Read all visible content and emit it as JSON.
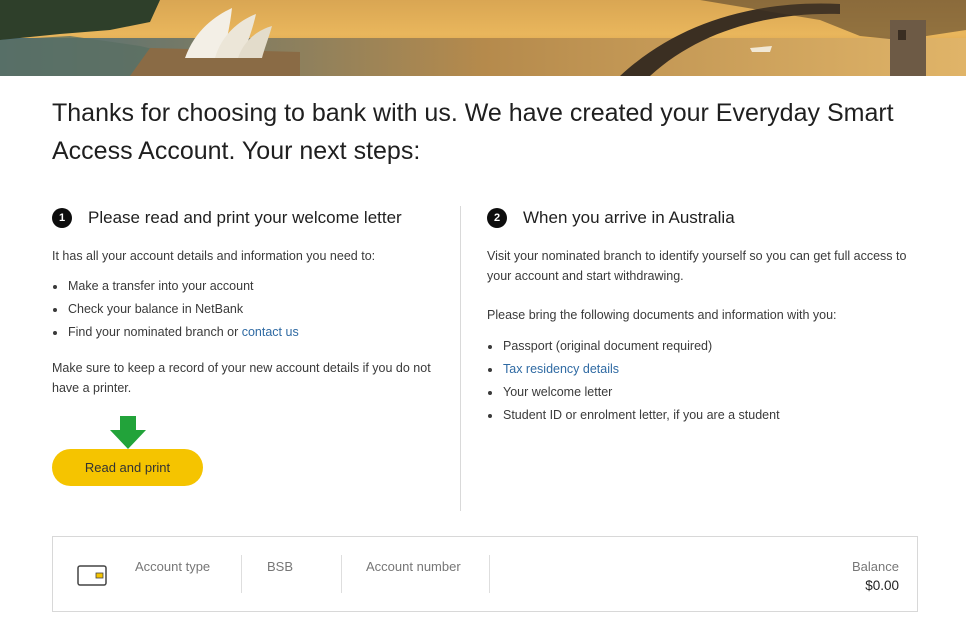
{
  "headline": "Thanks for choosing to bank with us. We have created your Everyday Smart Access Account. Your next steps:",
  "step1": {
    "number": "1",
    "title": "Please read and print your welcome letter",
    "intro": "It has all your account details and information you need to:",
    "items": [
      "Make a transfer into your account",
      "Check your balance in NetBank",
      "Find your nominated branch or "
    ],
    "link": "contact us",
    "note": "Make sure to keep a record of your new account details if you do not have a printer.",
    "button": "Read and print"
  },
  "step2": {
    "number": "2",
    "title": "When you arrive in Australia",
    "intro": "Visit your nominated branch to identify yourself so you can get full access to your account and start withdrawing.",
    "bring": "Please bring the following documents and information with you:",
    "items": [
      "Passport (original document required)",
      "Tax residency details",
      "Your welcome letter",
      "Student ID or enrolment letter, if you are a student"
    ]
  },
  "account": {
    "type_label": "Account type",
    "bsb_label": "BSB",
    "number_label": "Account number",
    "balance_label": "Balance",
    "balance_value": "$0.00"
  },
  "colors": {
    "button": "#f5c400",
    "link": "#2f6aa3",
    "arrow": "#22a33a"
  }
}
